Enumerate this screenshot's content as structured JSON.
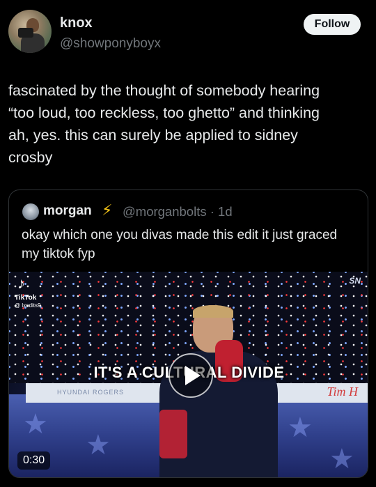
{
  "tweet": {
    "display_name": "knox",
    "handle": "@showponyboyx",
    "follow_label": "Follow",
    "text": "fascinated by the thought of somebody hearing\n“too loud, too reckless, too ghetto” and thinking\nah, yes. this can surely be applied to sidney\ncrosby"
  },
  "quote": {
    "display_name": "morgan",
    "handle_time": "@morganbolts · 1d",
    "text": "okay which one you divas made this edit it just graced my tiktok fyp",
    "media": {
      "caption": "IT'S A CULTURAL DIVIDE",
      "duration": "0:30",
      "tiktok_label": "TikTok",
      "tiktok_user": "@ lxedits9",
      "broadcaster_logo": "SN",
      "board_ad_left": "HYUNDAI  ROGERS",
      "board_ad_right": "Tim H"
    }
  }
}
